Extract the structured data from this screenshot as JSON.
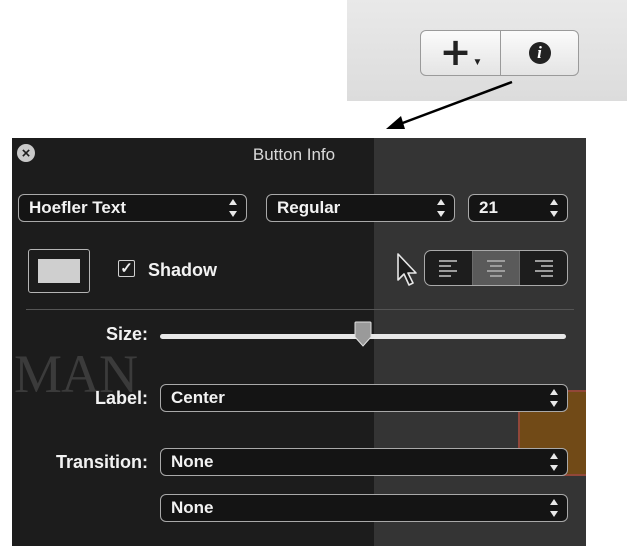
{
  "toolbar": {
    "add_icon": "plus-with-dropdown",
    "info_icon": "info-circle"
  },
  "panel": {
    "title": "Button Info",
    "font_family": "Hoefler Text",
    "font_style": "Regular",
    "font_size": "21",
    "shadow_label": "Shadow",
    "shadow_checked": true,
    "text_color": "#cfcfcf",
    "alignment": [
      "left",
      "center",
      "right"
    ],
    "alignment_selected": "center",
    "size_label": "Size:",
    "size_value": 0.5,
    "label_label": "Label:",
    "label_value": "Center",
    "transition_label": "Transition:",
    "transition_value_1": "None",
    "transition_value_2": "None",
    "background_text": "MAN"
  },
  "colors": {
    "panel_bg": "#1c1c1c",
    "toolbar_bg": "#e4e4e4"
  }
}
